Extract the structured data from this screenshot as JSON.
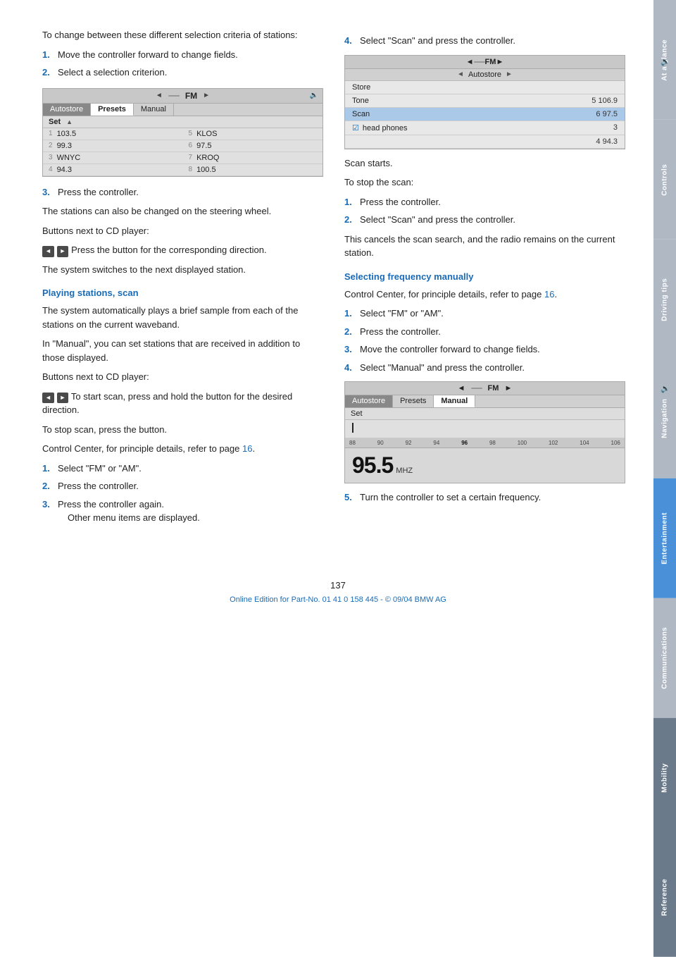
{
  "page": {
    "number": "137",
    "footer_text": "Online Edition for Part-No. 01 41 0 158 445 - © 09/04 BMW AG"
  },
  "side_tabs": [
    {
      "id": "at-a-glance",
      "label": "At a glance",
      "state": "inactive"
    },
    {
      "id": "controls",
      "label": "Controls",
      "state": "inactive"
    },
    {
      "id": "driving-tips",
      "label": "Driving tips",
      "state": "inactive"
    },
    {
      "id": "navigation",
      "label": "Navigation",
      "state": "inactive"
    },
    {
      "id": "entertainment",
      "label": "Entertainment",
      "state": "active"
    },
    {
      "id": "communications",
      "label": "Communications",
      "state": "inactive"
    },
    {
      "id": "mobility",
      "label": "Mobility",
      "state": "inactive"
    },
    {
      "id": "reference",
      "label": "Reference",
      "state": "inactive"
    }
  ],
  "left_col": {
    "intro_text": "To change between these different selection criteria of stations:",
    "steps_1": [
      {
        "num": "1.",
        "text": "Move the controller forward to change fields."
      },
      {
        "num": "2.",
        "text": "Select a selection criterion."
      }
    ],
    "step3_text": "3.",
    "step3_detail": "Press the controller.",
    "steer_text": "The stations can also be changed on the steering wheel.",
    "buttons_cd_label": "Buttons next to CD player:",
    "buttons_icon_text": "Press the button for the corresponding direction.",
    "buttons_switch_text": "The system switches to the next displayed station.",
    "section_scan": "Playing stations, scan",
    "scan_intro": "The system automatically plays a brief sample from each of the stations on the current waveband.",
    "scan_manual_note": "In \"Manual\", you can set stations that are received in addition to those displayed.",
    "scan_buttons_label": "Buttons next to CD player:",
    "scan_icon_text": "To start scan, press and hold the button for the desired direction.",
    "scan_stop_text": "To stop scan, press the button.",
    "scan_control_center": "Control Center, for principle details, refer to page 16.",
    "scan_steps": [
      {
        "num": "1.",
        "text": "Select \"FM\" or \"AM\"."
      },
      {
        "num": "2.",
        "text": "Press the controller."
      },
      {
        "num": "3.",
        "text": "Press the controller again.\n        Other menu items are displayed."
      }
    ],
    "radio_ui_1": {
      "header_left": "◄",
      "header_fm": "FM",
      "header_right": "►",
      "header_icon": "🔈",
      "tabs": [
        "Autostore",
        "Presets",
        "Manual"
      ],
      "active_tab": "Presets",
      "set_label": "Set",
      "presets": [
        {
          "num": "1",
          "label": "103.5",
          "right_num": "5",
          "right_label": "KLOS"
        },
        {
          "num": "2",
          "label": "99.3",
          "right_num": "6",
          "right_label": "97.5"
        },
        {
          "num": "3",
          "label": "WNYC",
          "right_num": "7",
          "right_label": "KROQ"
        },
        {
          "num": "4",
          "label": "94.3",
          "right_num": "8",
          "right_label": "100.5"
        }
      ]
    }
  },
  "right_col": {
    "step4_num": "4.",
    "step4_text": "Select \"Scan\" and press the controller.",
    "scan_starts_text": "Scan starts.",
    "stop_scan_label": "To stop the scan:",
    "stop_steps": [
      {
        "num": "1.",
        "text": "Press the controller."
      },
      {
        "num": "2.",
        "text": "Select \"Scan\" and press the controller."
      }
    ],
    "cancels_text": "This cancels the scan search, and the radio remains on the current station.",
    "section_manual": "Selecting frequency manually",
    "manual_intro": "Control Center, for principle details, refer to page 16.",
    "manual_steps": [
      {
        "num": "1.",
        "text": "Select \"FM\" or \"AM\"."
      },
      {
        "num": "2.",
        "text": "Press the controller."
      },
      {
        "num": "3.",
        "text": "Move the controller forward to change fields."
      },
      {
        "num": "4.",
        "text": "Select \"Manual\" and press the controller."
      }
    ],
    "step5_num": "5.",
    "step5_text": "Turn the controller to set a certain frequency.",
    "scan_ui": {
      "header_left": "◄",
      "header_fm": "FM",
      "header_right": "►",
      "header_icon": "🔈",
      "autostore_label": "◄ Autostore ►",
      "menu_items": [
        {
          "label": "Store",
          "value": "",
          "highlighted": false
        },
        {
          "label": "Tone",
          "value": "5 106.9",
          "highlighted": false
        },
        {
          "label": "Scan",
          "value": "6 97.5",
          "highlighted": true
        },
        {
          "label": "head phones",
          "value": "3",
          "highlighted": false,
          "check": true
        },
        {
          "label": "",
          "value": "4 94.3",
          "highlighted": false
        }
      ]
    },
    "manual_ui": {
      "header_left": "◄",
      "header_fm": "FM",
      "header_right": "►",
      "header_icon": "🔈",
      "tabs": [
        "Autostore",
        "Presets",
        "Manual"
      ],
      "active_tab": "Manual",
      "set_label": "Set",
      "freq_scale": [
        "88",
        "90",
        "92",
        "94",
        "96",
        "98",
        "100",
        "102",
        "104",
        "106"
      ],
      "big_frequency": "95.5",
      "big_unit": "MHZ"
    }
  }
}
